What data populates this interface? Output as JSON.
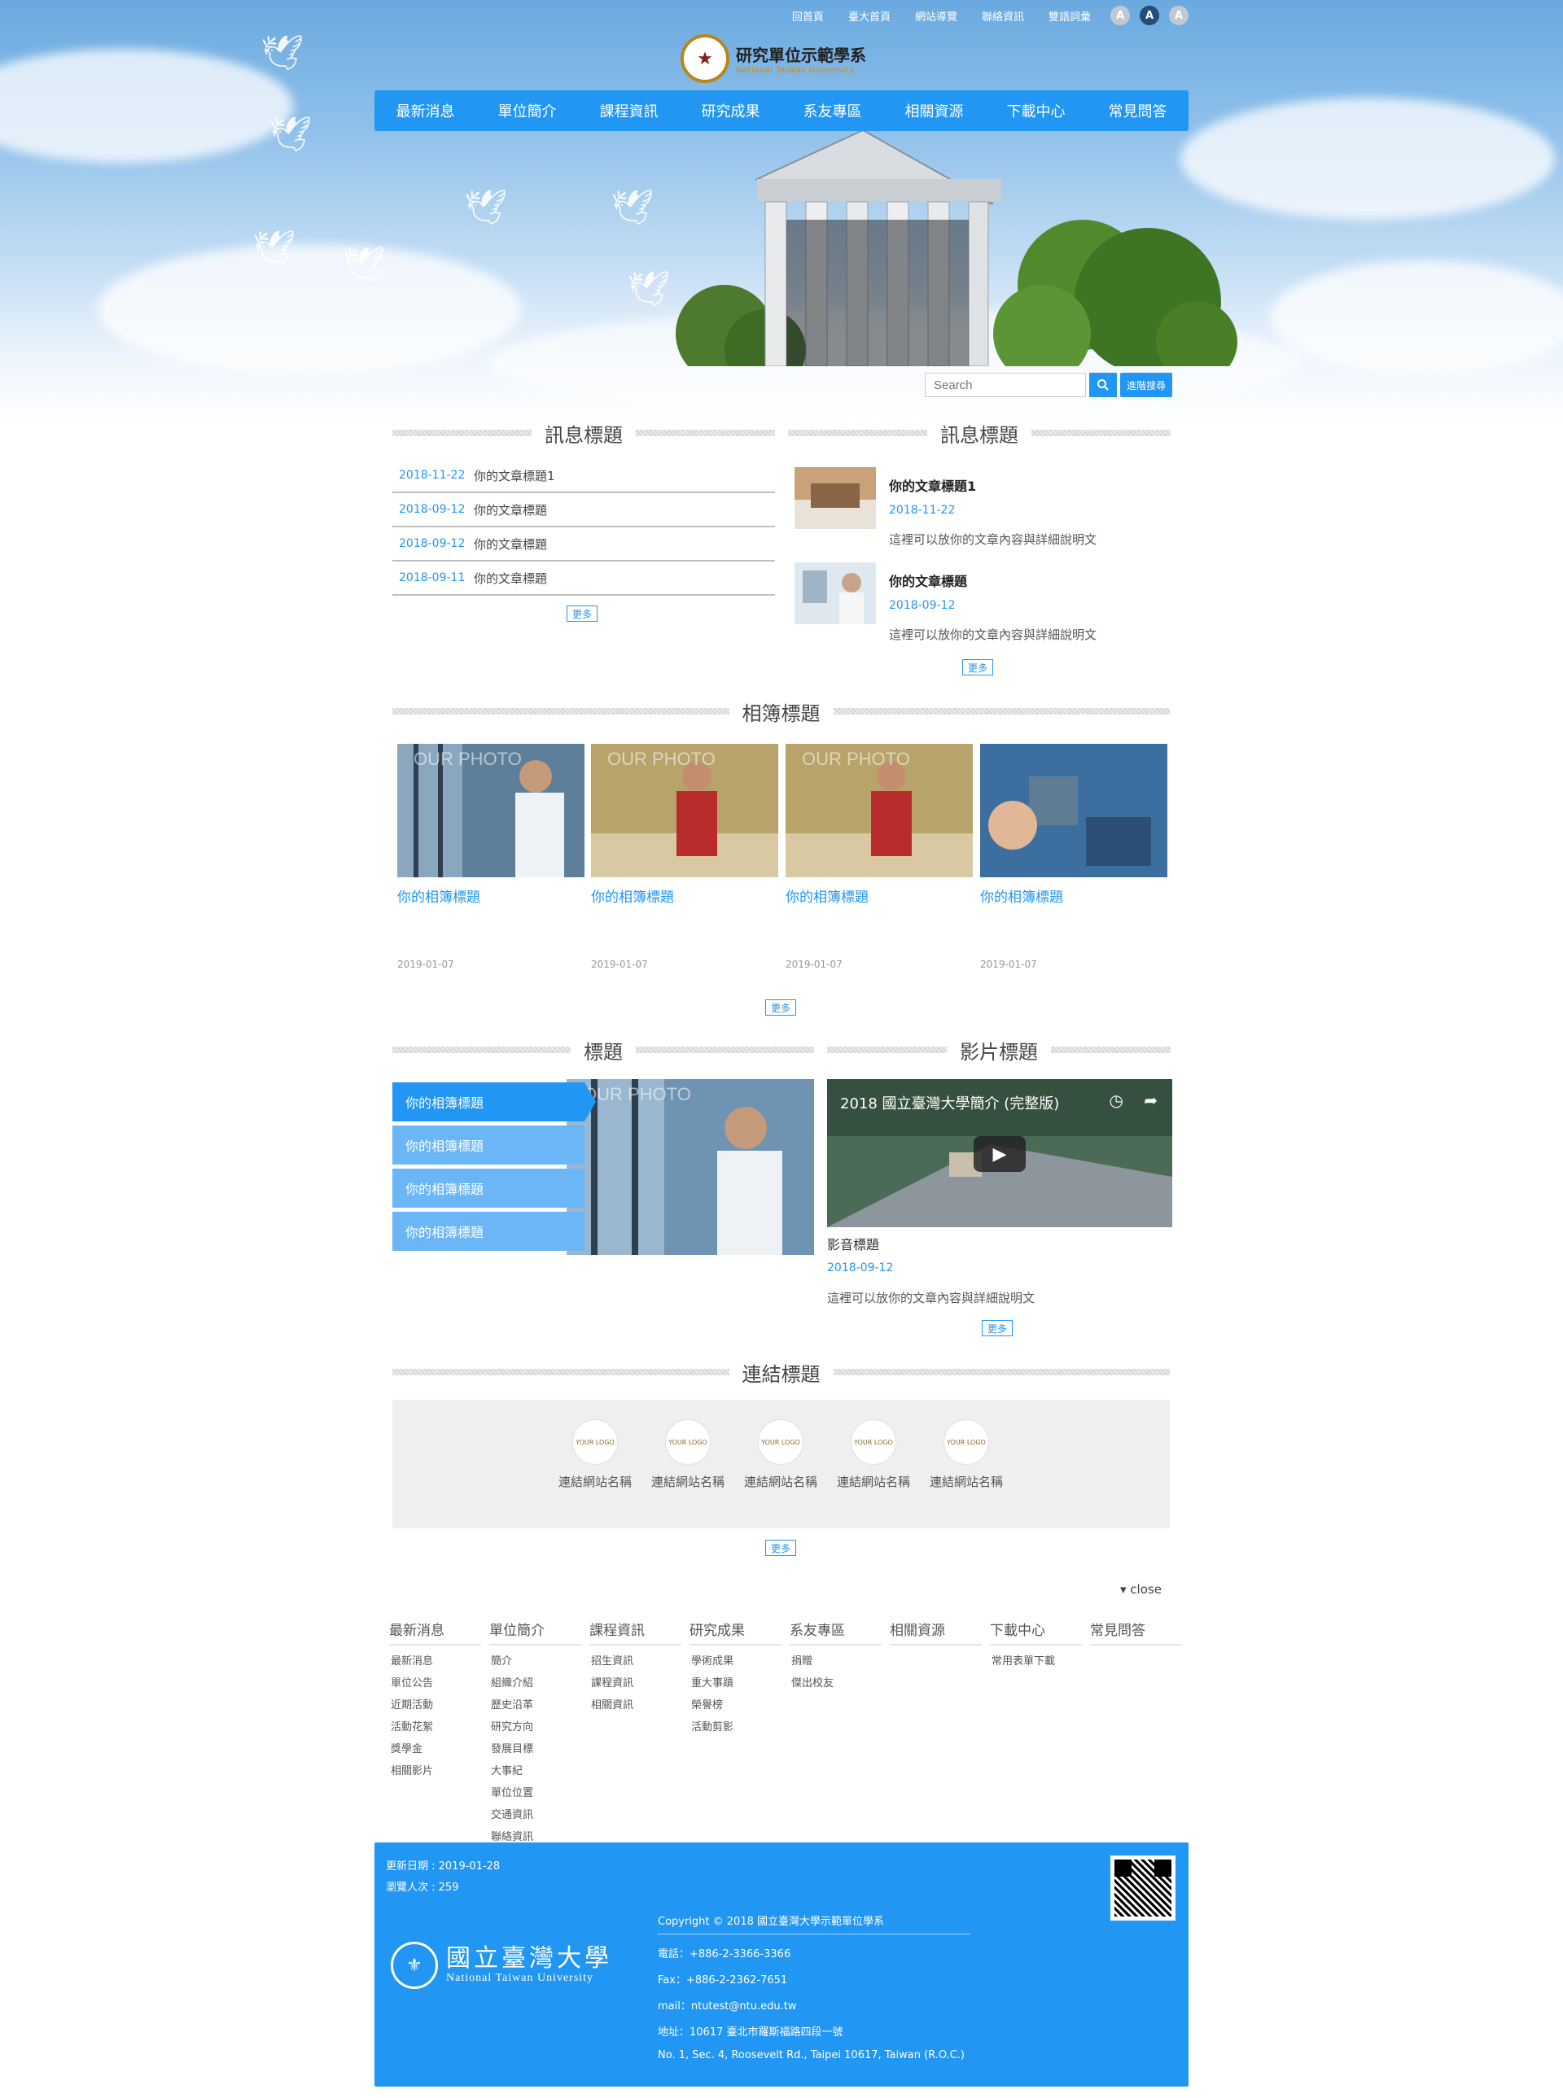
{
  "toplinks": [
    "回首頁",
    "臺大首頁",
    "網站導覽",
    "聯絡資訊",
    "雙語詞彙"
  ],
  "font_sizes": [
    "A",
    "A",
    "A"
  ],
  "logo": {
    "title": "研究單位示範學系",
    "subtitle": "National Taiwan University"
  },
  "nav": [
    "最新消息",
    "單位簡介",
    "課程資訊",
    "研究成果",
    "系友專區",
    "相關資源",
    "下載中心",
    "常見問答"
  ],
  "search": {
    "placeholder": "Search",
    "advanced": "進階搜尋"
  },
  "news_section": {
    "title": "訊息標題",
    "items": [
      {
        "date": "2018-11-22",
        "text": "你的文章標題1"
      },
      {
        "date": "2018-09-12",
        "text": "你的文章標題"
      },
      {
        "date": "2018-09-12",
        "text": "你的文章標題"
      },
      {
        "date": "2018-09-11",
        "text": "你的文章標題"
      }
    ],
    "more": "更多"
  },
  "article_section": {
    "title": "訊息標題",
    "items": [
      {
        "title": "你的文章標題1",
        "date": "2018-11-22",
        "desc": "這裡可以放你的文章內容與詳細說明文"
      },
      {
        "title": "你的文章標題",
        "date": "2018-09-12",
        "desc": "這裡可以放你的文章內容與詳細說明文"
      }
    ],
    "more": "更多"
  },
  "album_section": {
    "title": "相簿標題",
    "watermark": "OUR PHOTO",
    "items": [
      {
        "title": "你的相簿標題",
        "date": "2019-01-07"
      },
      {
        "title": "你的相簿標題",
        "date": "2019-01-07"
      },
      {
        "title": "你的相簿標題",
        "date": "2019-01-07"
      },
      {
        "title": "你的相簿標題",
        "date": "2019-01-07"
      }
    ],
    "more": "更多"
  },
  "slide_section": {
    "title": "標題",
    "tabs": [
      "你的相簿標題",
      "你的相簿標題",
      "你的相簿標題",
      "你的相簿標題"
    ]
  },
  "video_section": {
    "title": "影片標題",
    "video_title": "2018 國立臺灣大學簡介 (完整版)",
    "caption": "影音標題",
    "date": "2018-09-12",
    "desc": "這裡可以放你的文章內容與詳細說明文",
    "more": "更多"
  },
  "links_section": {
    "title": "連結標題",
    "logo_text": "YOUR LOGO",
    "items": [
      "連結網站名稱",
      "連結網站名稱",
      "連結網站名稱",
      "連結網站名稱",
      "連結網站名稱"
    ],
    "more": "更多"
  },
  "sitemap": {
    "close": "close",
    "columns": [
      {
        "head": "最新消息",
        "links": [
          "最新消息",
          "單位公告",
          "近期活動",
          "活動花絮",
          "獎學金",
          "相關影片"
        ]
      },
      {
        "head": "單位簡介",
        "links": [
          "簡介",
          "組織介紹",
          "歷史沿革",
          "研究方向",
          "發展目標",
          "大事紀",
          "單位位置",
          "交通資訊",
          "聯絡資訊"
        ]
      },
      {
        "head": "課程資訊",
        "links": [
          "招生資訊",
          "課程資訊",
          "相關資訊"
        ]
      },
      {
        "head": "研究成果",
        "links": [
          "學術成果",
          "重大事蹟",
          "榮譽榜",
          "活動剪影"
        ]
      },
      {
        "head": "系友專區",
        "links": [
          "捐贈",
          "傑出校友"
        ]
      },
      {
        "head": "相關資源",
        "links": []
      },
      {
        "head": "下載中心",
        "links": [
          "常用表單下載"
        ]
      },
      {
        "head": "常見問答",
        "links": []
      }
    ]
  },
  "footer": {
    "update": "更新日期 : 2019-01-28",
    "visits": "瀏覽人次 : 259",
    "ntu_name": "國立臺灣大學",
    "ntu_en": "National Taiwan University",
    "copyright": "Copyright © 2018 國立臺灣大學示範單位學系",
    "tel": "電話：+886-2-3366-3366",
    "fax": "Fax：+886-2-2362-7651",
    "mail": "mail：ntutest@ntu.edu.tw",
    "address": "地址：10617 臺北市羅斯福路四段一號",
    "address_en": "No. 1, Sec. 4, Roosevelt Rd., Taipei 10617, Taiwan (R.O.C.)"
  },
  "colors": {
    "primary": "#2196f3",
    "tab_light": "#6ab6f6",
    "link_bg": "#efefef"
  }
}
